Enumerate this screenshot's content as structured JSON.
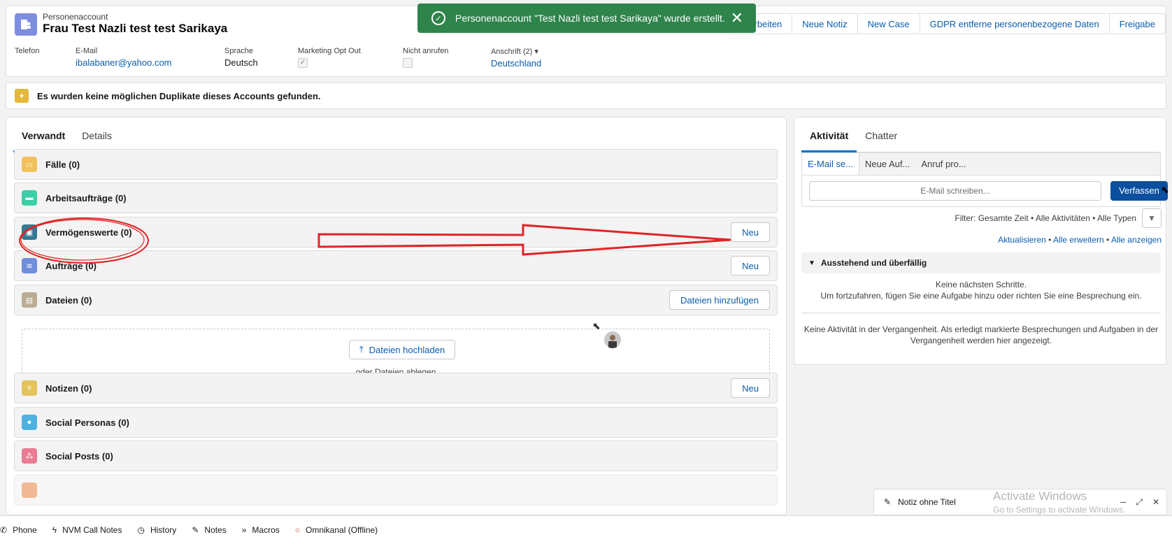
{
  "header": {
    "subtitle": "Personenaccount",
    "title": "Frau Test Nazli test test Sarikaya",
    "buttons": [
      "Bearbeiten",
      "Neue Notiz",
      "New Case",
      "GDPR entferne personenbezogene Daten",
      "Freigabe"
    ],
    "fields": {
      "phone_label": "Telefon",
      "email_label": "E-Mail",
      "email_value": "ibalabaner@yahoo.com",
      "language_label": "Sprache",
      "language_value": "Deutsch",
      "marketing_label": "Marketing Opt Out",
      "marketing_checked": true,
      "donotcall_label": "Nicht anrufen",
      "donotcall_checked": false,
      "address_label": "Anschrift (2)",
      "address_value": "Deutschland"
    }
  },
  "toast": {
    "message": "Personenaccount \"Test Nazli test test Sarikaya\" wurde erstellt.",
    "status_color": "#2e844a"
  },
  "duplicate_banner": {
    "text": "Es wurden keine möglichen Duplikate dieses Accounts gefunden."
  },
  "left_tabs": [
    "Verwandt",
    "Details"
  ],
  "related": [
    {
      "title": "Fälle (0)",
      "icon": "folder-icon",
      "color": "#f2c15c",
      "button": ""
    },
    {
      "title": "Arbeitsaufträge (0)",
      "icon": "truck-icon",
      "color": "#3bcfa5",
      "button": ""
    },
    {
      "title": "Vermögenswerte (0)",
      "icon": "asset-icon",
      "color": "#317a92",
      "button": "Neu"
    },
    {
      "title": "Aufträge (0)",
      "icon": "stack-icon",
      "color": "#6f8edb",
      "button": "Neu"
    },
    {
      "title": "Dateien (0)",
      "icon": "file-icon",
      "color": "#baac93",
      "button": "Dateien hinzufügen"
    },
    {
      "title": "Notizen (0)",
      "icon": "note-icon",
      "color": "#e3c45d",
      "button": "Neu"
    },
    {
      "title": "Social Personas (0)",
      "icon": "person-icon",
      "color": "#4fb1e0",
      "button": ""
    },
    {
      "title": "Social Posts (0)",
      "icon": "share-icon",
      "color": "#ec7a92",
      "button": ""
    }
  ],
  "files_drop": {
    "upload_label": "Dateien hochladen",
    "drop_label": "oder Dateien ablegen"
  },
  "right_tabs": [
    "Aktivität",
    "Chatter"
  ],
  "publisher": {
    "tabs": [
      "E-Mail se...",
      "Neue Auf...",
      "Anruf pro..."
    ],
    "email_placeholder": "E-Mail schreiben...",
    "compose_label": "Verfassen"
  },
  "activity": {
    "filter_text": "Filter: Gesamte Zeit • Alle Aktivitäten • Alle Typen",
    "links": [
      "Aktualisieren",
      "Alle erweitern",
      "Alle anzeigen"
    ],
    "pending_title": "Ausstehend und überfällig",
    "no_next_1": "Keine nächsten Schritte.",
    "no_next_2": "Um fortzufahren, fügen Sie eine Aufgabe hinzu oder richten Sie eine Besprechung ein.",
    "no_past": "Keine Aktivität in der Vergangenheit. Als erledigt markierte Besprechungen und Aufgaben in der Vergangenheit werden hier angezeigt."
  },
  "utility_bar": [
    "Phone",
    "NVM Call Notes",
    "History",
    "Notes",
    "Macros",
    "Omnikanal (Offline)"
  ],
  "note_panel": {
    "title": "Notiz ohne Titel"
  },
  "watermark": {
    "line1": "Activate Windows",
    "line2": "Go to Settings to activate Windows."
  }
}
